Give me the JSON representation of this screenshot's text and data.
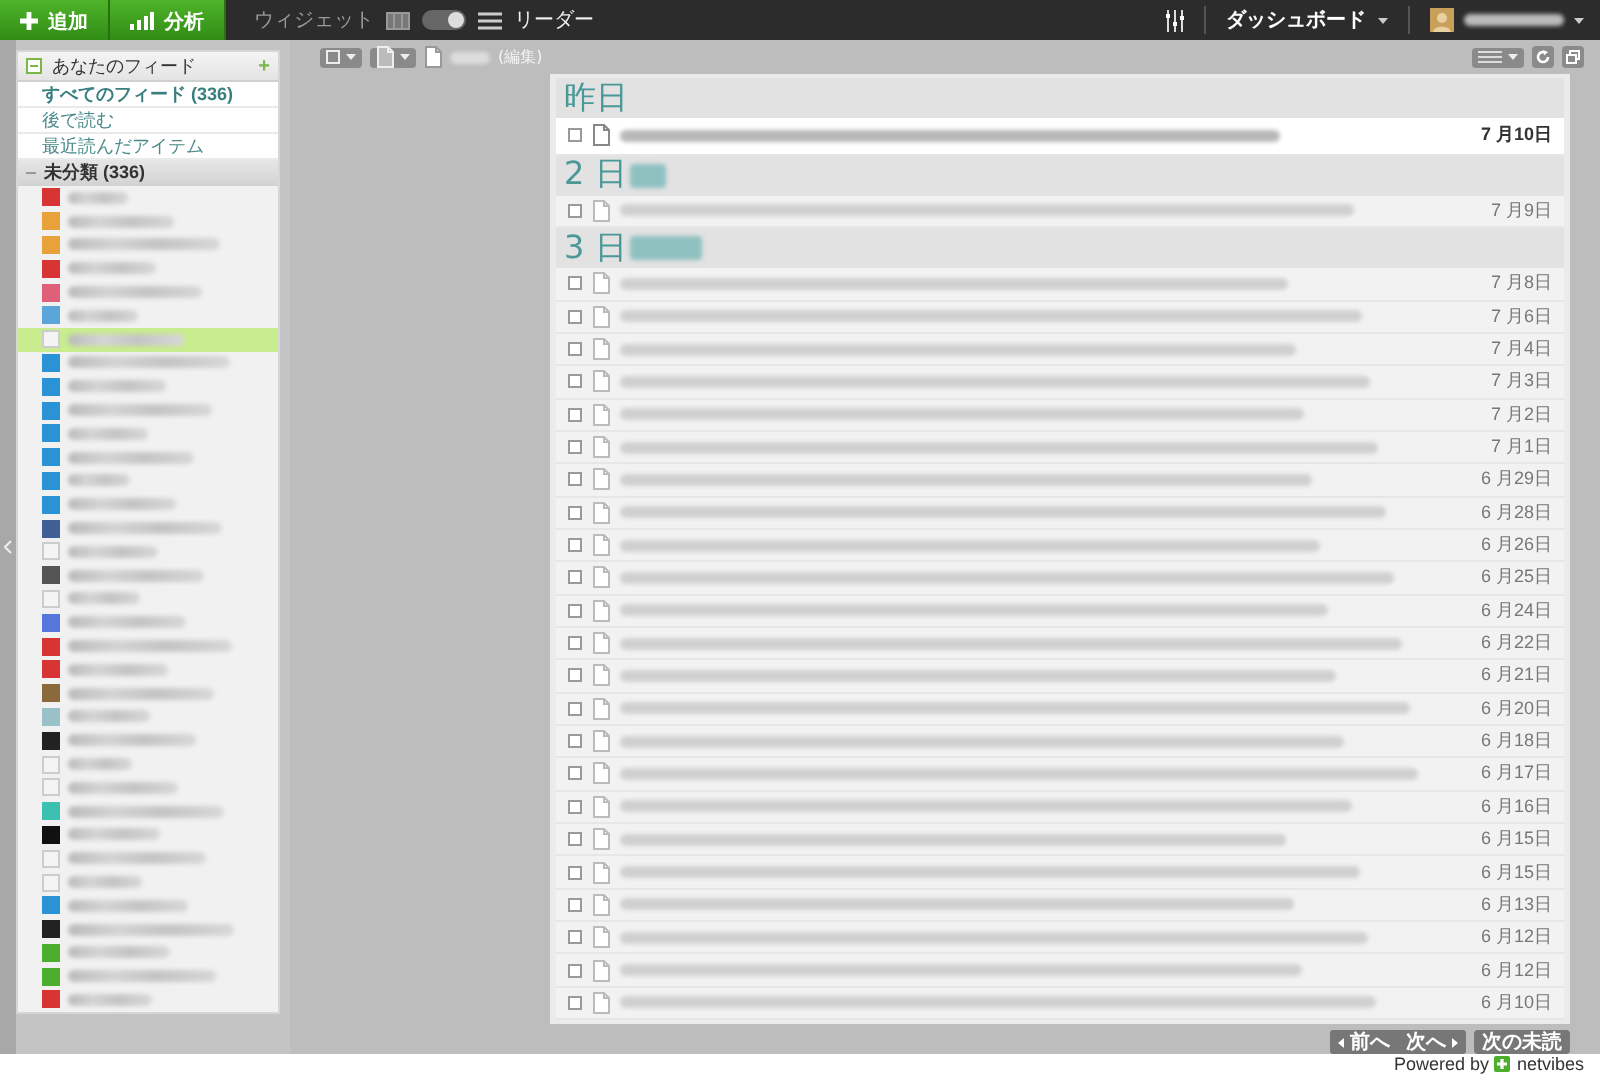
{
  "topbar": {
    "add_button": "追加",
    "analyze_button": "分析",
    "widget_label": "ウィジェット",
    "view_toggle": {
      "on": true
    },
    "reader_label": "リーダー",
    "dashboard_menu": "ダッシュボード"
  },
  "sidebar": {
    "header": "あなたのフィード",
    "header_action": "+",
    "links": [
      {
        "label": "すべてのフィード (336)",
        "selected": true
      },
      {
        "label": "後で読む",
        "selected": false
      },
      {
        "label": "最近読んだアイテム",
        "selected": false
      }
    ],
    "category": {
      "label": "未分類 (336)",
      "expanded": true
    },
    "feeds": [
      {
        "color": "#d83434",
        "selected": false
      },
      {
        "color": "#e9a23a",
        "selected": false
      },
      {
        "color": "#e9a23a",
        "selected": false
      },
      {
        "color": "#d83434",
        "selected": false
      },
      {
        "color": "#e0607a",
        "selected": false
      },
      {
        "color": "#5aa6d8",
        "selected": false
      },
      {
        "color": "#f4f4f4",
        "selected": true
      },
      {
        "color": "#2a93d5",
        "selected": false
      },
      {
        "color": "#2a93d5",
        "selected": false
      },
      {
        "color": "#2a93d5",
        "selected": false
      },
      {
        "color": "#2a93d5",
        "selected": false
      },
      {
        "color": "#2a93d5",
        "selected": false
      },
      {
        "color": "#2a93d5",
        "selected": false
      },
      {
        "color": "#2a93d5",
        "selected": false
      },
      {
        "color": "#3f5f95",
        "selected": false
      },
      {
        "color": "#f4f4f4",
        "selected": false
      },
      {
        "color": "#555555",
        "selected": false
      },
      {
        "color": "#f4f4f4",
        "selected": false
      },
      {
        "color": "#5577dd",
        "selected": false
      },
      {
        "color": "#d83434",
        "selected": false
      },
      {
        "color": "#d83434",
        "selected": false
      },
      {
        "color": "#8a6a3a",
        "selected": false
      },
      {
        "color": "#9ac0c8",
        "selected": false
      },
      {
        "color": "#222222",
        "selected": false
      },
      {
        "color": "#f4f4f4",
        "selected": false
      },
      {
        "color": "#f4f4f4",
        "selected": false
      },
      {
        "color": "#3cc0b0",
        "selected": false
      },
      {
        "color": "#111111",
        "selected": false
      },
      {
        "color": "#f4f4f4",
        "selected": false
      },
      {
        "color": "#f4f4f4",
        "selected": false
      },
      {
        "color": "#2a93d5",
        "selected": false
      },
      {
        "color": "#222222",
        "selected": false
      },
      {
        "color": "#4cae2c",
        "selected": false
      },
      {
        "color": "#4cae2c",
        "selected": false
      },
      {
        "color": "#d83434",
        "selected": false
      }
    ]
  },
  "toolbar": {
    "edit_link": "(編集)"
  },
  "groups": [
    {
      "heading": "昨日",
      "items": [
        {
          "date": "7 月10日",
          "read": false
        }
      ]
    },
    {
      "heading": "2 日",
      "items": [
        {
          "date": "7 月9日",
          "read": true
        }
      ]
    },
    {
      "heading": "3 日",
      "items": [
        {
          "date": "7 月8日",
          "read": true
        },
        {
          "date": "7 月6日",
          "read": true
        },
        {
          "date": "7 月4日",
          "read": true
        },
        {
          "date": "7 月3日",
          "read": true
        },
        {
          "date": "7 月2日",
          "read": true
        },
        {
          "date": "7 月1日",
          "read": true
        },
        {
          "date": "6 月29日",
          "read": true
        },
        {
          "date": "6 月28日",
          "read": true
        },
        {
          "date": "6 月26日",
          "read": true
        },
        {
          "date": "6 月25日",
          "read": true
        },
        {
          "date": "6 月24日",
          "read": true
        },
        {
          "date": "6 月22日",
          "read": true
        },
        {
          "date": "6 月21日",
          "read": true
        },
        {
          "date": "6 月20日",
          "read": true
        },
        {
          "date": "6 月18日",
          "read": true
        },
        {
          "date": "6 月17日",
          "read": true
        },
        {
          "date": "6 月16日",
          "read": true
        },
        {
          "date": "6 月15日",
          "read": true
        },
        {
          "date": "6 月15日",
          "read": true
        },
        {
          "date": "6 月13日",
          "read": true
        },
        {
          "date": "6 月12日",
          "read": true
        },
        {
          "date": "6 月12日",
          "read": true
        },
        {
          "date": "6 月10日",
          "read": true
        }
      ]
    }
  ],
  "pagination": {
    "prev": "前へ",
    "next": "次へ",
    "next_unread": "次の未読"
  },
  "footer": {
    "powered_by": "Powered by",
    "brand": "netvibes"
  }
}
